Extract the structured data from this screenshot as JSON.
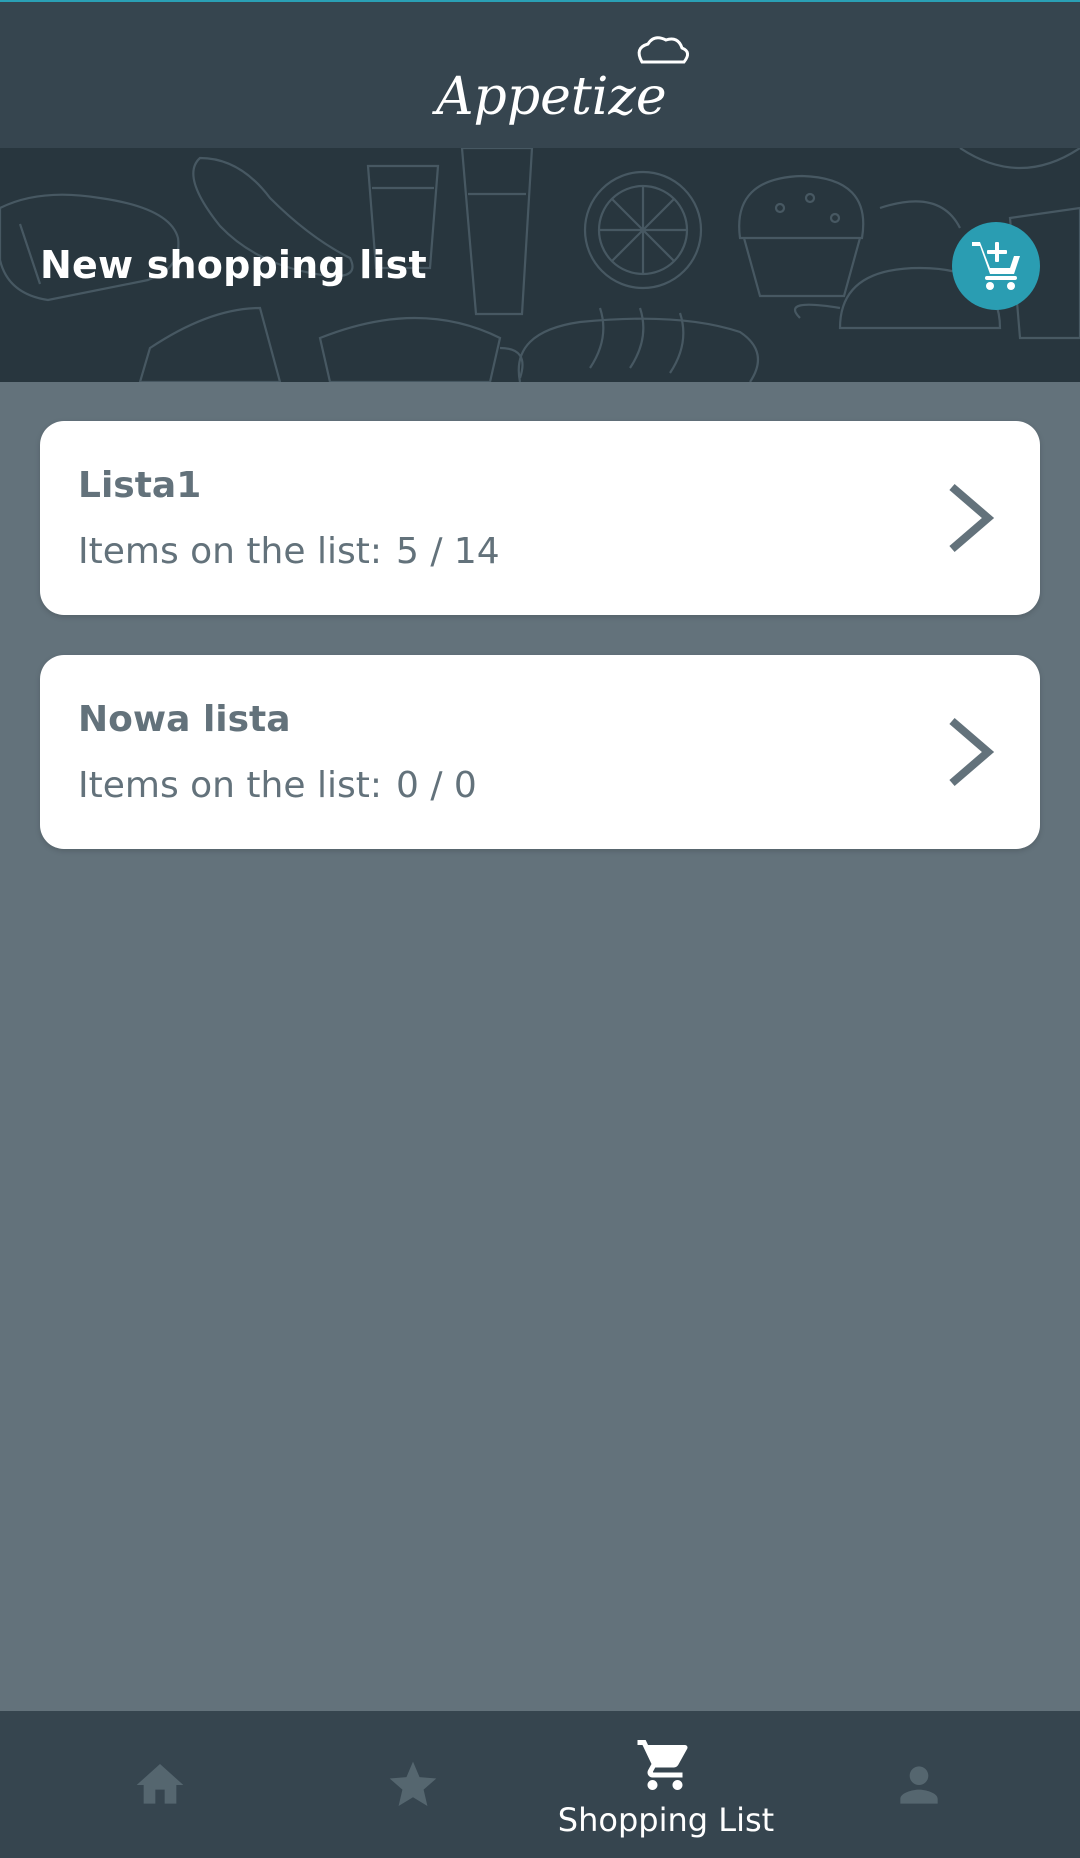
{
  "app": {
    "logo_text": "Appetize"
  },
  "banner": {
    "title": "New shopping list",
    "add_button_icon": "add-cart-icon"
  },
  "lists": [
    {
      "name": "Lista1",
      "items_label": "Items on the list:",
      "count": "5 / 14",
      "checked": 5,
      "total": 14
    },
    {
      "name": "Nowa lista",
      "items_label": "Items on the list:",
      "count": "0 / 0",
      "checked": 0,
      "total": 0
    }
  ],
  "nav": {
    "items": [
      {
        "icon": "home-icon",
        "label": "",
        "active": false
      },
      {
        "icon": "star-icon",
        "label": "",
        "active": false
      },
      {
        "icon": "cart-icon",
        "label": "Shopping List",
        "active": true
      },
      {
        "icon": "user-icon",
        "label": "",
        "active": false
      }
    ]
  },
  "colors": {
    "header": "#36454f",
    "background": "#63727b",
    "accent": "#2a9db2",
    "card": "#ffffff",
    "text_muted": "#63727b"
  }
}
